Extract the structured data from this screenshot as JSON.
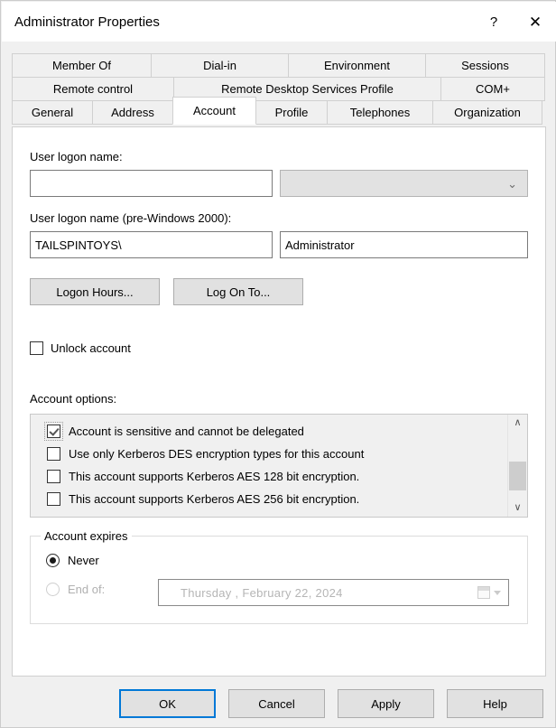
{
  "window": {
    "title": "Administrator Properties",
    "help_button": "?",
    "close_button": "✕"
  },
  "tabs": {
    "row1": [
      {
        "label": "Member Of",
        "selected": false
      },
      {
        "label": "Dial-in",
        "selected": false
      },
      {
        "label": "Environment",
        "selected": false
      },
      {
        "label": "Sessions",
        "selected": false
      }
    ],
    "row2": [
      {
        "label": "Remote control",
        "selected": false
      },
      {
        "label": "Remote Desktop Services Profile",
        "selected": false
      },
      {
        "label": "COM+",
        "selected": false
      }
    ],
    "row3": [
      {
        "label": "General",
        "selected": false
      },
      {
        "label": "Address",
        "selected": false
      },
      {
        "label": "Account",
        "selected": true
      },
      {
        "label": "Profile",
        "selected": false
      },
      {
        "label": "Telephones",
        "selected": false
      },
      {
        "label": "Organization",
        "selected": false
      }
    ]
  },
  "account": {
    "logon_name_label": "User logon name:",
    "logon_name_value": "",
    "logon_name_placeholder": "",
    "upn_suffix_value": "",
    "upn_suffix_chevron": "⌄",
    "pre2000_label": "User logon name (pre-Windows 2000):",
    "pre2000_domain": "TAILSPINTOYS\\",
    "pre2000_user": "Administrator",
    "logon_hours_button": "Logon Hours...",
    "log_on_to_button": "Log On To...",
    "unlock_account_label": "Unlock account",
    "unlock_account_checked": false,
    "options_label": "Account options:",
    "options": [
      {
        "label": "Account is sensitive and cannot be delegated",
        "checked": true,
        "focused": true
      },
      {
        "label": "Use only Kerberos DES encryption types for this account",
        "checked": false,
        "focused": false
      },
      {
        "label": "This account supports Kerberos AES 128 bit encryption.",
        "checked": false,
        "focused": false
      },
      {
        "label": "This account supports Kerberos AES 256 bit encryption.",
        "checked": false,
        "focused": false
      }
    ],
    "scroll_up_glyph": "∧",
    "scroll_down_glyph": "∨"
  },
  "expires": {
    "group_title": "Account expires",
    "never_label": "Never",
    "never_selected": true,
    "end_of_label": "End of:",
    "end_of_selected": false,
    "end_of_enabled": false,
    "date_value": "Thursday  ,  February  22, 2024"
  },
  "footer": {
    "ok": "OK",
    "cancel": "Cancel",
    "apply": "Apply",
    "help": "Help"
  },
  "colors": {
    "accent": "#0078d7",
    "dialog_bg": "#f0f0f0",
    "panel_bg": "#ffffff",
    "disabled_text": "#b0b0b0"
  }
}
